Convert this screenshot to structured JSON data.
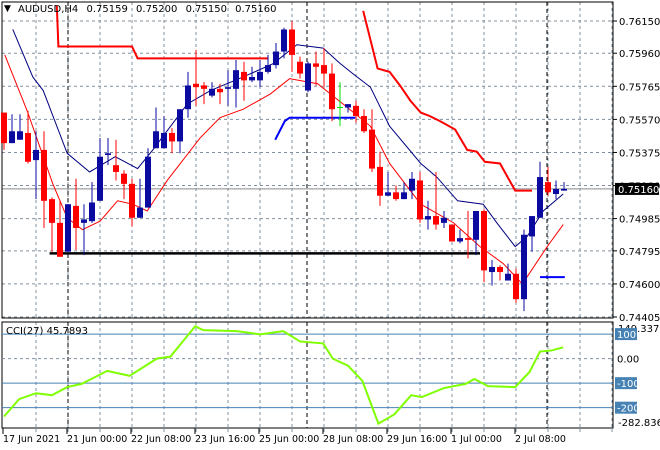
{
  "header": {
    "symbol": "AUDUSD,H4",
    "open": "0.75159",
    "high": "0.75200",
    "low": "0.75150",
    "close": "0.75160"
  },
  "indicator": {
    "name": "CCI(27)",
    "value": "45.7893"
  },
  "price_axis": {
    "labels": [
      "0.76150",
      "0.75960",
      "0.75765",
      "0.75570",
      "0.75375",
      "0.75180",
      "0.74985",
      "0.74795",
      "0.74600",
      "0.74405"
    ],
    "current_price": "0.75160"
  },
  "cci_axis": {
    "max": "149.3378",
    "min": "-282.8367",
    "levels": [
      "100",
      "0.00",
      "-100",
      "-200"
    ]
  },
  "time_axis": [
    "17 Jun 2021",
    "21 Jun 00:00",
    "22 Jun 08:00",
    "23 Jun 16:00",
    "25 Jun 00:00",
    "28 Jun 08:00",
    "29 Jun 16:00",
    "1 Jul 00:00",
    "2 Jul 08:00"
  ],
  "colors": {
    "bull": "#0a0aa0",
    "bear": "#ff0000",
    "doji": "#00e000",
    "cci": "#7fff00",
    "level": "#4682b4",
    "tag": "#4682b4"
  },
  "chart_data": {
    "type": "candlestick",
    "title": "AUDUSD,H4",
    "ylim": [
      0.74405,
      0.7615
    ],
    "candles_ohlc": [
      [
        0.7561,
        0.7561,
        0.7539,
        0.7543
      ],
      [
        0.7543,
        0.756,
        0.7543,
        0.755
      ],
      [
        0.7545,
        0.756,
        0.7545,
        0.755
      ],
      [
        0.7549,
        0.7562,
        0.7531,
        0.7532
      ],
      [
        0.7533,
        0.755,
        0.751,
        0.7539
      ],
      [
        0.7539,
        0.755,
        0.7493,
        0.7509
      ],
      [
        0.751,
        0.7511,
        0.7479,
        0.7496
      ],
      [
        0.7496,
        0.7509,
        0.7476,
        0.7476
      ],
      [
        0.7479,
        0.7507,
        0.7479,
        0.7507
      ],
      [
        0.7506,
        0.7522,
        0.748,
        0.7493
      ],
      [
        0.7496,
        0.7507,
        0.7477,
        0.7498
      ],
      [
        0.7497,
        0.752,
        0.7496,
        0.7508
      ],
      [
        0.7509,
        0.7546,
        0.7509,
        0.7535
      ],
      [
        0.7536,
        0.7546,
        0.753,
        0.7537
      ],
      [
        0.753,
        0.7545,
        0.7521,
        0.7526
      ],
      [
        0.7525,
        0.7527,
        0.751,
        0.7519
      ],
      [
        0.7519,
        0.7522,
        0.7494,
        0.7499
      ],
      [
        0.7499,
        0.7522,
        0.7499,
        0.7505
      ],
      [
        0.7505,
        0.754,
        0.7505,
        0.7535
      ],
      [
        0.754,
        0.7564,
        0.754,
        0.755
      ],
      [
        0.754,
        0.7559,
        0.754,
        0.7549
      ],
      [
        0.7549,
        0.7552,
        0.7537,
        0.7544
      ],
      [
        0.7544,
        0.7563,
        0.7537,
        0.7563
      ],
      [
        0.7563,
        0.7585,
        0.7558,
        0.7577
      ],
      [
        0.7578,
        0.7598,
        0.7565,
        0.7576
      ],
      [
        0.7577,
        0.7579,
        0.7566,
        0.7575
      ],
      [
        0.7571,
        0.7579,
        0.757,
        0.7575
      ],
      [
        0.7575,
        0.7578,
        0.7566,
        0.7573
      ],
      [
        0.7575,
        0.7586,
        0.7565,
        0.7576
      ],
      [
        0.7575,
        0.7592,
        0.7564,
        0.7586
      ],
      [
        0.7585,
        0.7591,
        0.7568,
        0.758
      ],
      [
        0.758,
        0.7588,
        0.7579,
        0.7582
      ],
      [
        0.758,
        0.7592,
        0.7576,
        0.7585
      ],
      [
        0.7585,
        0.7595,
        0.7584,
        0.7589
      ],
      [
        0.7589,
        0.7602,
        0.7587,
        0.7597
      ],
      [
        0.7597,
        0.7611,
        0.7593,
        0.761
      ],
      [
        0.761,
        0.7615,
        0.7585,
        0.7595
      ],
      [
        0.7591,
        0.7594,
        0.7581,
        0.7584
      ],
      [
        0.7574,
        0.7591,
        0.7573,
        0.759
      ],
      [
        0.759,
        0.7597,
        0.7577,
        0.7588
      ],
      [
        0.7589,
        0.7599,
        0.7576,
        0.7584
      ],
      [
        0.7584,
        0.759,
        0.7556,
        0.7563
      ],
      [
        0.7564,
        0.7579,
        0.7553,
        0.7564
      ],
      [
        0.7564,
        0.7566,
        0.7561,
        0.7566
      ],
      [
        0.7565,
        0.7568,
        0.7555,
        0.7559
      ],
      [
        0.7559,
        0.7563,
        0.7549,
        0.755
      ],
      [
        0.7551,
        0.7563,
        0.7526,
        0.7528
      ],
      [
        0.7529,
        0.7538,
        0.7506,
        0.7512
      ],
      [
        0.7512,
        0.7526,
        0.7512,
        0.7514
      ],
      [
        0.7514,
        0.7518,
        0.7509,
        0.751
      ],
      [
        0.751,
        0.752,
        0.751,
        0.7514
      ],
      [
        0.7515,
        0.7526,
        0.751,
        0.7522
      ],
      [
        0.7521,
        0.7526,
        0.7496,
        0.7498
      ],
      [
        0.7498,
        0.7509,
        0.7492,
        0.75
      ],
      [
        0.75,
        0.7526,
        0.7492,
        0.7495
      ],
      [
        0.7496,
        0.7503,
        0.7493,
        0.7499
      ],
      [
        0.7495,
        0.7495,
        0.7485,
        0.7485
      ],
      [
        0.7485,
        0.7492,
        0.7484,
        0.7487
      ],
      [
        0.7487,
        0.7503,
        0.7475,
        0.7486
      ],
      [
        0.7486,
        0.7503,
        0.7477,
        0.7503
      ],
      [
        0.7503,
        0.7504,
        0.7461,
        0.7468
      ],
      [
        0.7467,
        0.7474,
        0.7459,
        0.747
      ],
      [
        0.747,
        0.7471,
        0.7462,
        0.7467
      ],
      [
        0.7462,
        0.7472,
        0.7462,
        0.7466
      ],
      [
        0.7466,
        0.7469,
        0.7449,
        0.7451
      ],
      [
        0.7451,
        0.7492,
        0.7444,
        0.7489
      ],
      [
        0.7488,
        0.75,
        0.7479,
        0.75
      ],
      [
        0.7499,
        0.7532,
        0.7499,
        0.7523
      ],
      [
        0.752,
        0.7529,
        0.7512,
        0.7514
      ],
      [
        0.7513,
        0.7521,
        0.751,
        0.7516
      ],
      [
        0.7515,
        0.752,
        0.7515,
        0.7516
      ]
    ],
    "doji_indices": [
      42
    ],
    "fast_ma": [
      [
        1.1,
        0.761
      ],
      [
        3.6,
        0.7582
      ],
      [
        4.9,
        0.7574
      ],
      [
        7.9,
        0.7537
      ],
      [
        10.7,
        0.7526
      ],
      [
        13.9,
        0.7535
      ],
      [
        16.7,
        0.7528
      ],
      [
        18.6,
        0.7539
      ],
      [
        22.9,
        0.7566
      ],
      [
        25.8,
        0.7574
      ],
      [
        29.9,
        0.7582
      ],
      [
        33.7,
        0.759
      ],
      [
        36.6,
        0.7601
      ],
      [
        39.9,
        0.7599
      ],
      [
        42,
        0.759
      ],
      [
        43.6,
        0.7584
      ],
      [
        45.8,
        0.7576
      ],
      [
        48.2,
        0.7553
      ],
      [
        52.1,
        0.7531
      ],
      [
        54.1,
        0.7523
      ],
      [
        56.7,
        0.7509
      ],
      [
        59.9,
        0.7507
      ],
      [
        61.6,
        0.7496
      ],
      [
        63.9,
        0.7482
      ],
      [
        65.4,
        0.7488
      ],
      [
        67.4,
        0.7503
      ],
      [
        69.9,
        0.7513
      ]
    ],
    "slow_ma": [
      [
        0.1,
        0.7595
      ],
      [
        2.9,
        0.7562
      ],
      [
        6.1,
        0.7519
      ],
      [
        7.9,
        0.7499
      ],
      [
        9.8,
        0.7492
      ],
      [
        12,
        0.7497
      ],
      [
        14.2,
        0.7509
      ],
      [
        16.1,
        0.7507
      ],
      [
        17.9,
        0.7503
      ],
      [
        20.4,
        0.7521
      ],
      [
        24.5,
        0.7546
      ],
      [
        27,
        0.7558
      ],
      [
        29.9,
        0.7563
      ],
      [
        33.3,
        0.7572
      ],
      [
        35.7,
        0.7581
      ],
      [
        39.2,
        0.7578
      ],
      [
        42.4,
        0.7566
      ],
      [
        45.8,
        0.7553
      ],
      [
        48.2,
        0.7531
      ],
      [
        52.1,
        0.7507
      ],
      [
        56.2,
        0.7496
      ],
      [
        59.5,
        0.7482
      ],
      [
        62.4,
        0.7472
      ],
      [
        64.8,
        0.746
      ],
      [
        67.9,
        0.7482
      ],
      [
        69.9,
        0.7495
      ]
    ],
    "upper_step": [
      [
        [
          6.6,
          0.7624
        ],
        [
          6.8,
          0.76
        ],
        [
          16,
          0.76
        ],
        [
          16.7,
          0.7593
        ],
        [
          33,
          0.7593
        ]
      ],
      [
        [
          44.9,
          0.7621
        ],
        [
          46.7,
          0.7587
        ],
        [
          48.2,
          0.7585
        ],
        [
          49.5,
          0.7577
        ],
        [
          50.8,
          0.7568
        ],
        [
          52.1,
          0.7561
        ],
        [
          53.2,
          0.7559
        ],
        [
          54.5,
          0.7556
        ],
        [
          56.4,
          0.7551
        ],
        [
          57.9,
          0.7539
        ],
        [
          59.1,
          0.7538
        ],
        [
          60.1,
          0.7532
        ],
        [
          62,
          0.7531
        ],
        [
          63.9,
          0.7515
        ],
        [
          66,
          0.7515
        ]
      ]
    ],
    "support_line": [
      [
        5.7,
        0.7478
      ],
      [
        59.5,
        0.7478
      ]
    ],
    "lower_step": [
      [
        [
          33.9,
          0.7545
        ],
        [
          35.1,
          0.7556
        ],
        [
          35.7,
          0.7558
        ],
        [
          43.9,
          0.7558
        ]
      ],
      [
        [
          67,
          0.7464
        ],
        [
          70.1,
          0.7464
        ]
      ]
    ],
    "cci": [
      [
        0,
        -236
      ],
      [
        1.9,
        -165
      ],
      [
        4,
        -141
      ],
      [
        6,
        -149
      ],
      [
        7.9,
        -116
      ],
      [
        9.7,
        -103
      ],
      [
        12.9,
        -50
      ],
      [
        15.7,
        -70
      ],
      [
        19.1,
        0
      ],
      [
        20.8,
        8
      ],
      [
        23.9,
        132
      ],
      [
        24.9,
        116
      ],
      [
        29.1,
        112
      ],
      [
        32,
        99
      ],
      [
        34.9,
        112
      ],
      [
        37,
        70
      ],
      [
        39.9,
        62
      ],
      [
        41.1,
        0
      ],
      [
        43,
        -29
      ],
      [
        44.8,
        -91
      ],
      [
        46.8,
        -265
      ],
      [
        48.8,
        -227
      ],
      [
        50.9,
        -149
      ],
      [
        52.2,
        -157
      ],
      [
        55,
        -120
      ],
      [
        57.7,
        -103
      ],
      [
        58.8,
        -83
      ],
      [
        60.5,
        -112
      ],
      [
        63.9,
        -116
      ],
      [
        65.7,
        -54
      ],
      [
        67,
        29
      ],
      [
        68.4,
        33
      ],
      [
        69.9,
        46
      ]
    ],
    "cci_range": [
      -282.8367,
      149.3378
    ]
  }
}
